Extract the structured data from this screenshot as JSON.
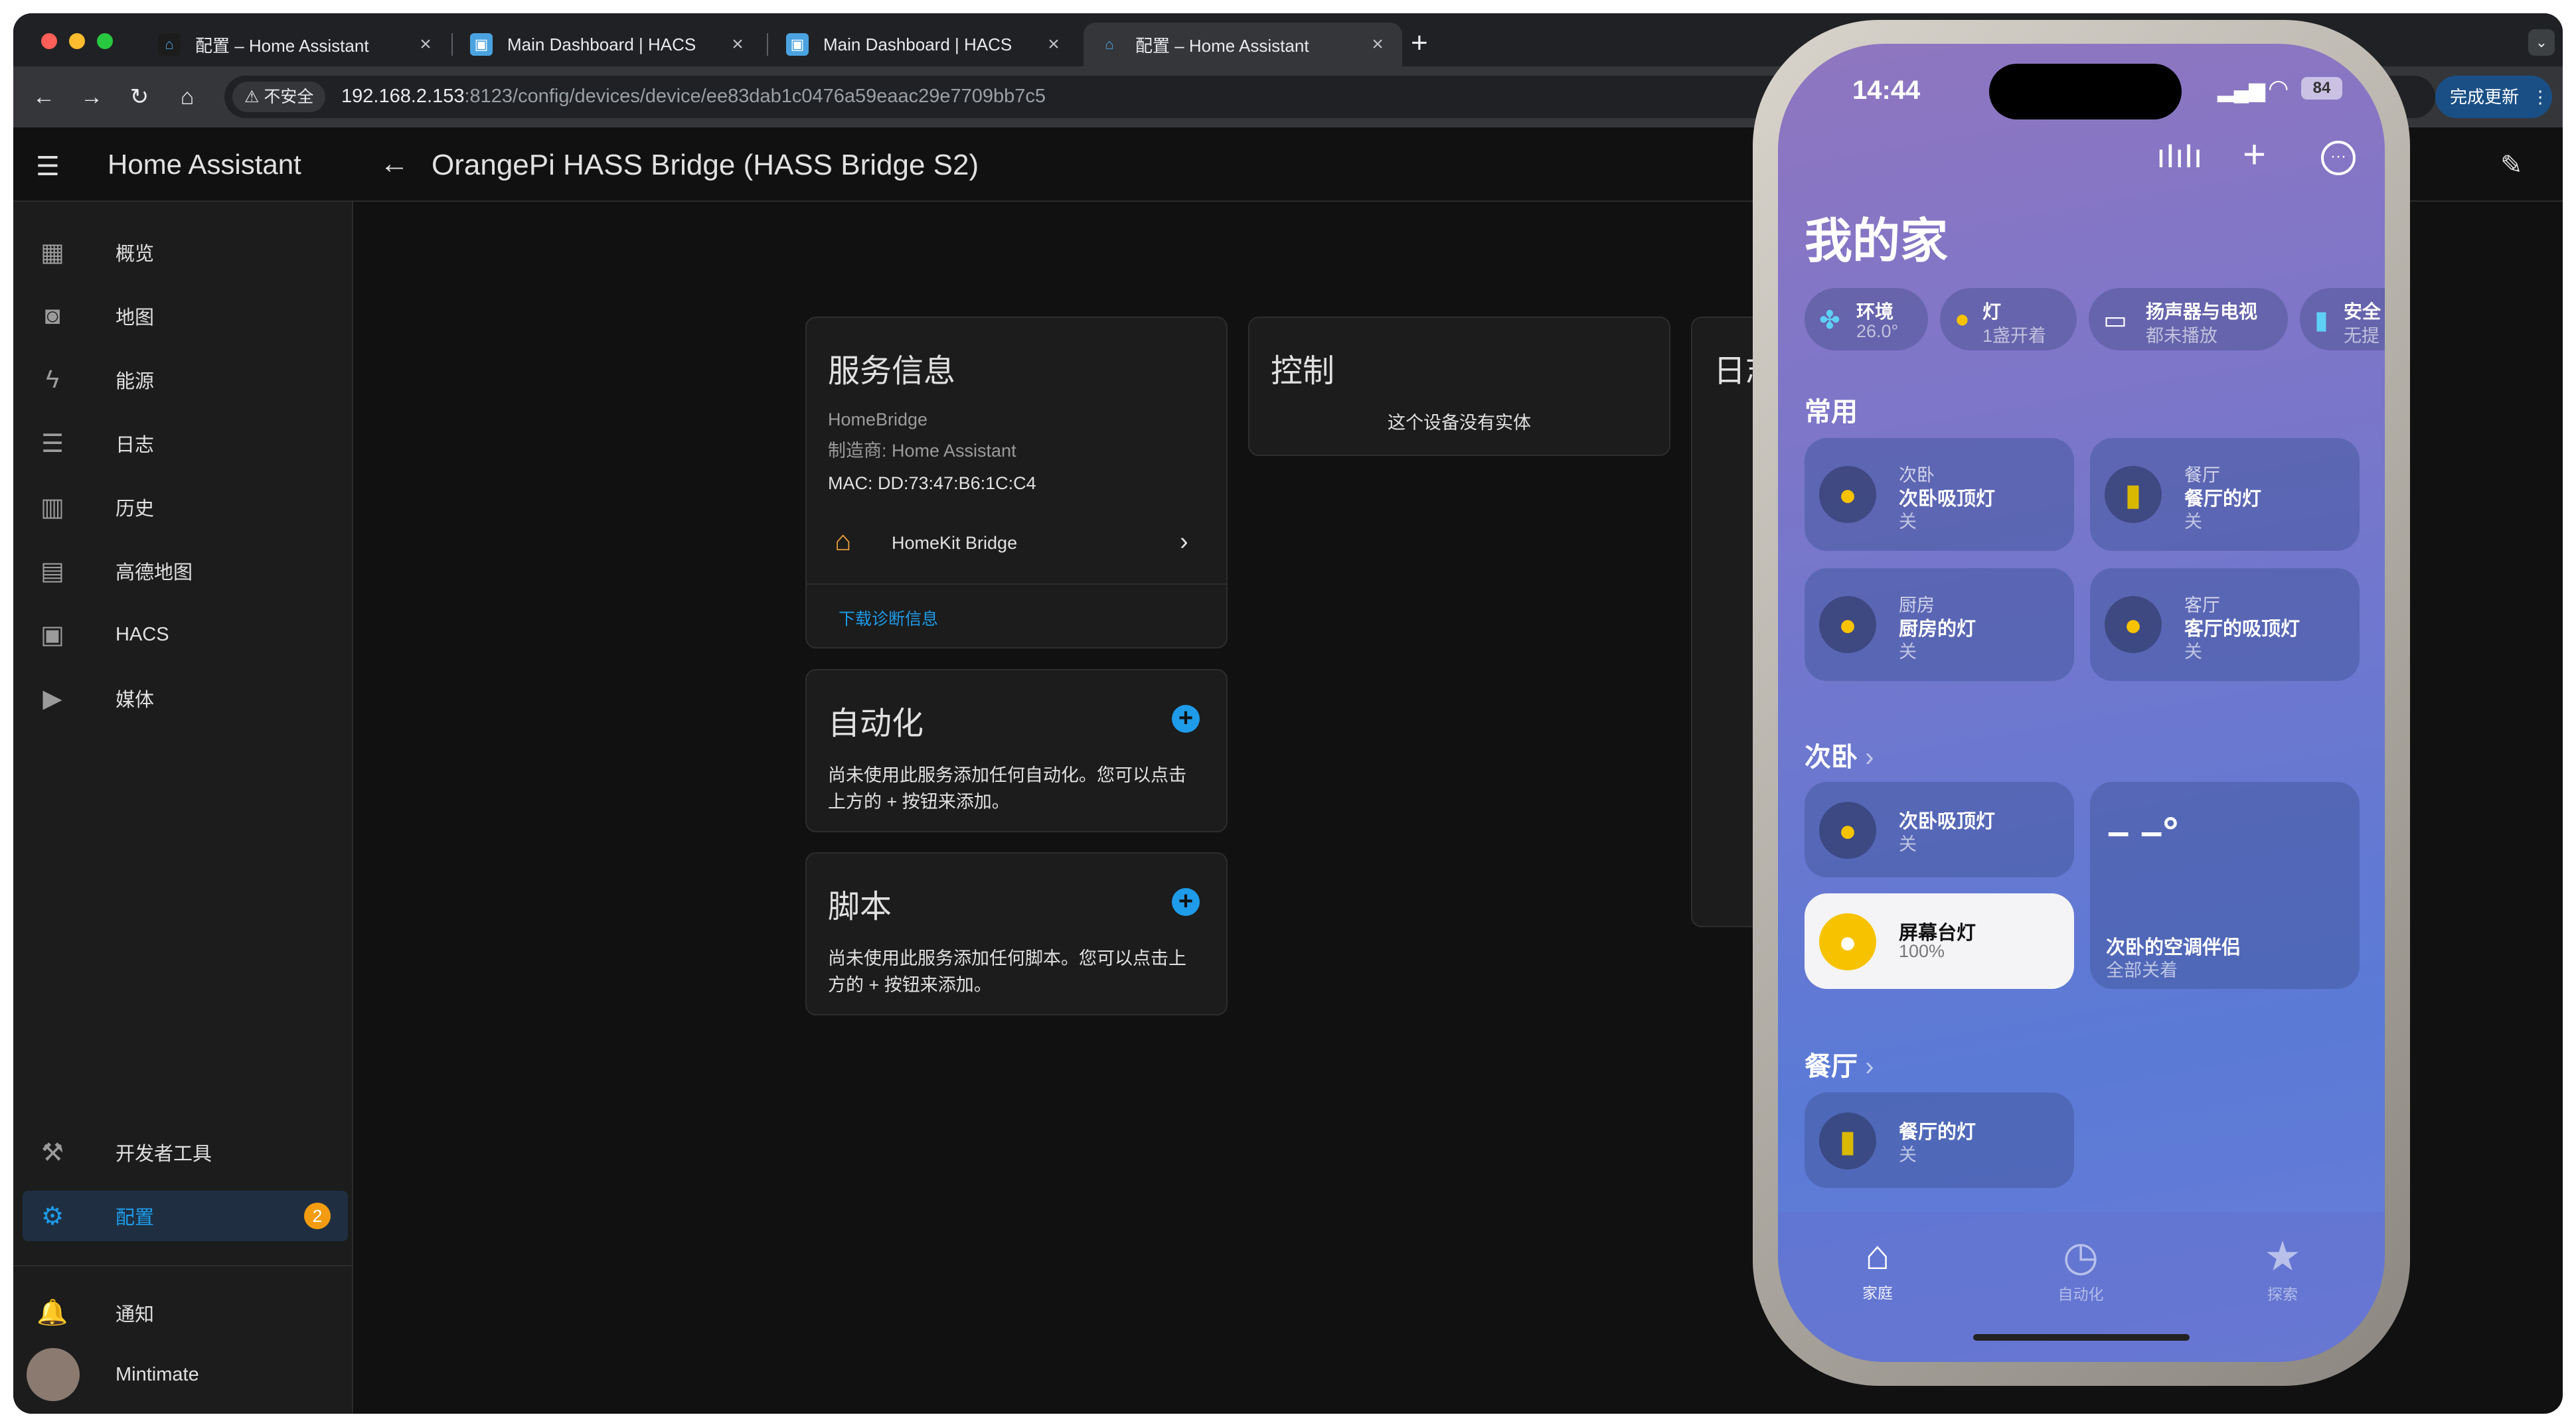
{
  "browser": {
    "tabs": [
      {
        "title": "配置 – Home Assistant",
        "active": false
      },
      {
        "title": "Main Dashboard | HACS",
        "active": false
      },
      {
        "title": "Main Dashboard | HACS",
        "active": false
      },
      {
        "title": "配置 – Home Assistant",
        "active": true
      }
    ],
    "insecure_label": "不安全",
    "url_host": "192.168.2.153",
    "url_rest": ":8123/config/devices/device/ee83dab1c0476a59eaac29e7709bb7c5",
    "update_button": "完成更新"
  },
  "header": {
    "app_title": "Home Assistant",
    "page_title": "OrangePi HASS Bridge (HASS Bridge S2)"
  },
  "sidebar": {
    "items": [
      {
        "label": "概览",
        "icon": "dashboard-icon"
      },
      {
        "label": "地图",
        "icon": "map-account-icon"
      },
      {
        "label": "能源",
        "icon": "lightning-icon"
      },
      {
        "label": "日志",
        "icon": "list-icon"
      },
      {
        "label": "历史",
        "icon": "chart-bar-icon"
      },
      {
        "label": "高德地图",
        "icon": "map-icon"
      },
      {
        "label": "HACS",
        "icon": "hacs-icon"
      },
      {
        "label": "媒体",
        "icon": "play-box-icon"
      }
    ],
    "dev_tools": "开发者工具",
    "config": "配置",
    "config_badge": "2",
    "notifications": "通知",
    "user": "Mintimate"
  },
  "service_card": {
    "title": "服务信息",
    "model": "HomeBridge",
    "manufacturer": "制造商: Home Assistant",
    "mac": "MAC: DD:73:47:B6:1C:C4",
    "integration": "HomeKit Bridge",
    "download_diag": "下载诊断信息"
  },
  "controls_card": {
    "title": "控制",
    "empty": "这个设备没有实体"
  },
  "logbook_card": {
    "title": "日志"
  },
  "automation_card": {
    "title": "自动化",
    "line1": "尚未使用此服务添加任何自动化。您可以点击",
    "line2": "上方的 + 按钮来添加。"
  },
  "script_card": {
    "title": "脚本",
    "line1": "尚未使用此服务添加任何脚本。您可以点击上",
    "line2": "方的 + 按钮来添加。"
  },
  "phone": {
    "time": "14:44",
    "battery": "84",
    "home_title": "我的家",
    "chips": [
      {
        "l1": "环境",
        "l2": "26.0°"
      },
      {
        "l1": "灯",
        "l2": "1盏开着"
      },
      {
        "l1": "扬声器与电视",
        "l2": "都未播放"
      },
      {
        "l1": "安全",
        "l2": "无提"
      }
    ],
    "favorites_title": "常用",
    "favorites": [
      {
        "room": "次卧",
        "name": "次卧吸顶灯",
        "state": "关"
      },
      {
        "room": "餐厅",
        "name": "餐厅的灯",
        "state": "关"
      },
      {
        "room": "厨房",
        "name": "厨房的灯",
        "state": "关"
      },
      {
        "room": "客厅",
        "name": "客厅的吸顶灯",
        "state": "关"
      }
    ],
    "bedroom_title": "次卧",
    "bedroom": [
      {
        "name": "次卧吸顶灯",
        "state": "关"
      },
      {
        "name": "屏幕台灯",
        "state": "100%"
      }
    ],
    "ac": {
      "temp": "– –°",
      "name": "次卧的空调伴侣",
      "state": "全部关着"
    },
    "dining_title": "餐厅",
    "dining": [
      {
        "name": "餐厅的灯",
        "state": "关"
      }
    ],
    "dock": [
      {
        "label": "家庭",
        "icon": "house-icon"
      },
      {
        "label": "自动化",
        "icon": "clock-check-icon"
      },
      {
        "label": "探索",
        "icon": "star-icon"
      }
    ]
  },
  "colors": {
    "accent": "#1e9be9",
    "badge": "#f39c12",
    "bulb": "#f7c300"
  }
}
